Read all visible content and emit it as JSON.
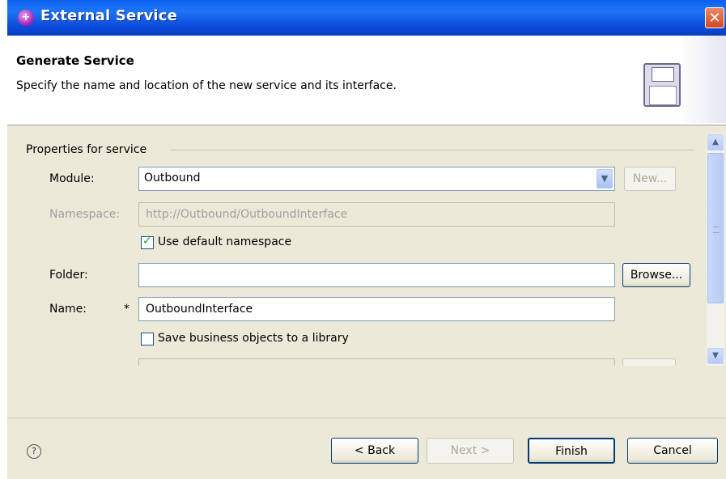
{
  "window": {
    "title": "External Service",
    "close_symbol": "✕"
  },
  "banner": {
    "title": "Generate Service",
    "description": "Specify the name and location of the new service and its interface."
  },
  "group": {
    "label": "Properties for service"
  },
  "module": {
    "label": "Module:",
    "value": "Outbound",
    "new_button": "New..."
  },
  "namespace": {
    "label": "Namespace:",
    "value": "http://Outbound/OutboundInterface"
  },
  "use_default_namespace": {
    "label": "Use default namespace",
    "checked": true
  },
  "folder": {
    "label": "Folder:",
    "value": "",
    "browse_button": "Browse..."
  },
  "name": {
    "label": "Name:",
    "required_marker": "*",
    "value": "OutboundInterface"
  },
  "save_to_library": {
    "label": "Save business objects to a library",
    "checked": false
  },
  "footer": {
    "help_symbol": "?",
    "back": "< Back",
    "next": "Next >",
    "finish": "Finish",
    "cancel": "Cancel"
  },
  "colors": {
    "titlebar": "#0a5ff0",
    "accent_check": "#21a121",
    "close": "#d4471f"
  },
  "icons": [
    "app-icon",
    "close-icon",
    "floppy-disk-icon",
    "dropdown-arrow-icon",
    "scroll-up-icon",
    "scroll-down-icon",
    "help-icon",
    "checkmark-icon"
  ]
}
